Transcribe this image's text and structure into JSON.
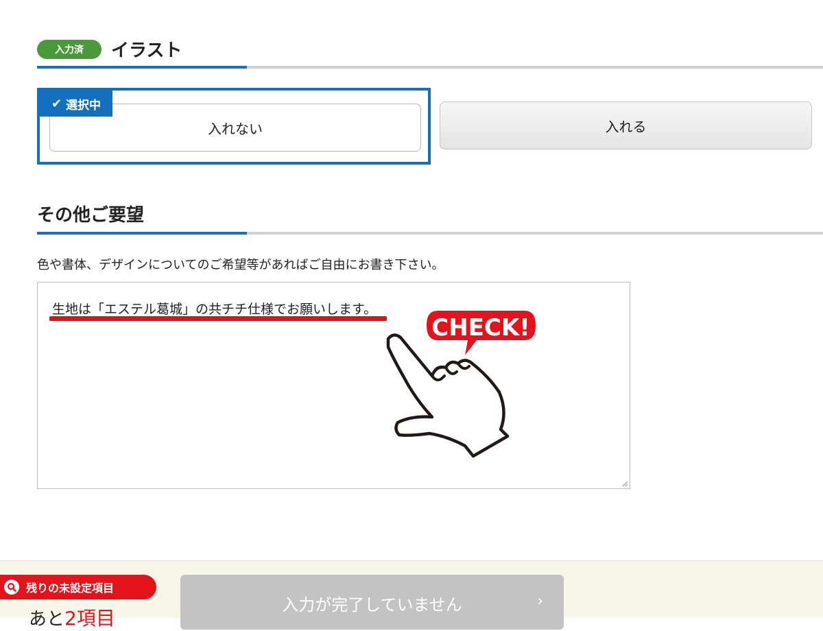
{
  "illustration": {
    "status_badge": "入力済",
    "title": "イラスト",
    "selected_tag": "選択中",
    "options": [
      {
        "label": "入れない",
        "selected": true
      },
      {
        "label": "入れる",
        "selected": false
      }
    ]
  },
  "requests": {
    "title": "その他ご要望",
    "hint": "色や書体、デザインについてのご希望等があればご自由にお書き下さい。",
    "value": "生地は「エステル葛城」の共チチ仕様でお願いします。",
    "check_label": "CHECK!"
  },
  "footer": {
    "remaining_label": "残りの未設定項目",
    "remaining_prefix": "あと",
    "remaining_number": "2",
    "remaining_suffix": "項目",
    "submit_label": "入力が完了していません",
    "submit_chevron": "›"
  },
  "colors": {
    "accent_blue": "#1470bd",
    "done_green": "#4a9a3c",
    "alert_red": "#e3131b"
  }
}
